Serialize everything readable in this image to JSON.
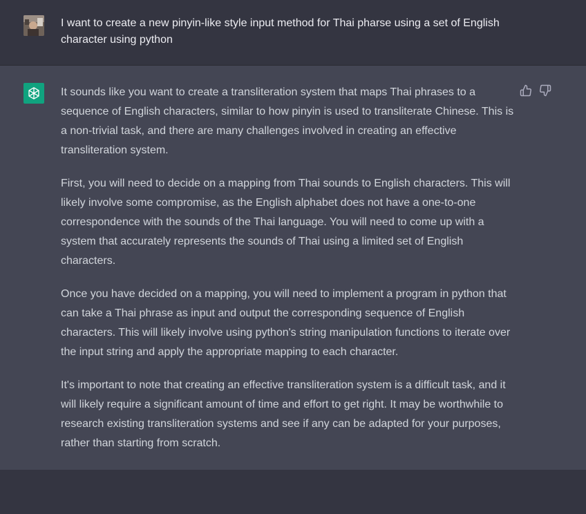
{
  "user": {
    "message": "I want to create a new pinyin-like style input method for Thai pharse using a set of English character using python"
  },
  "assistant": {
    "paragraphs": [
      "It sounds like you want to create a transliteration system that maps Thai phrases to a sequence of English characters, similar to how pinyin is used to transliterate Chinese. This is a non-trivial task, and there are many challenges involved in creating an effective transliteration system.",
      "First, you will need to decide on a mapping from Thai sounds to English characters. This will likely involve some compromise, as the English alphabet does not have a one-to-one correspondence with the sounds of the Thai language. You will need to come up with a system that accurately represents the sounds of Thai using a limited set of English characters.",
      "Once you have decided on a mapping, you will need to implement a program in python that can take a Thai phrase as input and output the corresponding sequence of English characters. This will likely involve using python's string manipulation functions to iterate over the input string and apply the appropriate mapping to each character.",
      "It's important to note that creating an effective transliteration system is a difficult task, and it will likely require a significant amount of time and effort to get right. It may be worthwhile to research existing transliteration systems and see if any can be adapted for your purposes, rather than starting from scratch."
    ]
  },
  "icons": {
    "user_avatar": "user-avatar",
    "assistant_logo": "openai-logo-icon",
    "thumbs_up": "thumbs-up-icon",
    "thumbs_down": "thumbs-down-icon"
  },
  "colors": {
    "background": "#343541",
    "assistant_background": "#444654",
    "logo_green": "#10a37f",
    "text_user": "#ececf1",
    "text_assistant": "#d1d5db"
  }
}
